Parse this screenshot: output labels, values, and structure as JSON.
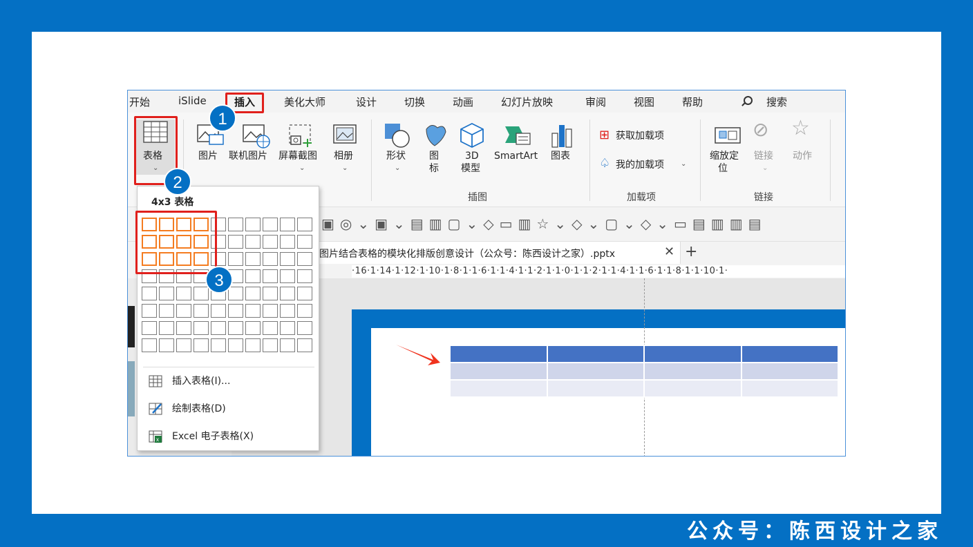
{
  "footer": {
    "text": "公众号：陈西设计之家"
  },
  "menu": {
    "tabs": [
      "开始",
      "iSlide",
      "插入",
      "美化大师",
      "设计",
      "切换",
      "动画",
      "幻灯片放映",
      "审阅",
      "视图",
      "帮助"
    ],
    "active": "插入",
    "search_label": "搜索"
  },
  "ribbon": {
    "table": {
      "label": "表格"
    },
    "images": {
      "picture": "图片",
      "online_picture": "联机图片",
      "screenshot": "屏幕截图",
      "album": "相册"
    },
    "illustrations": {
      "shapes": "形状",
      "icons_1": "图",
      "icons_2": "标",
      "model_1": "3D",
      "model_2": "模型",
      "smartart": "SmartArt",
      "chart": "图表",
      "group": "插图"
    },
    "addins": {
      "get": "获取加载项",
      "mine": "我的加载项",
      "group": "加载项"
    },
    "links": {
      "zoom_1": "缩放定",
      "zoom_2": "位",
      "link": "链接",
      "action": "动作",
      "group": "链接"
    }
  },
  "document": {
    "tab_title": "图片结合表格的模块化排版创意设计（公众号：陈西设计之家）.pptx",
    "ruler": "·16·1·14·1·12·1·10·1·8·1·1·6·1·1·4·1·1·2·1·1·0·1·1·2·1·1·4·1·1·6·1·1·8·1·1·10·1·"
  },
  "dropdown": {
    "title": "4x3 表格",
    "grid": {
      "cols": 10,
      "rows": 8,
      "selected_cols": 4,
      "selected_rows": 3
    },
    "items": [
      {
        "label": "插入表格(I)...",
        "icon": "table-icon"
      },
      {
        "label": "绘制表格(D)",
        "icon": "draw-table-icon"
      },
      {
        "label": "Excel 电子表格(X)",
        "icon": "excel-icon"
      }
    ]
  },
  "badges": [
    "1",
    "2",
    "3"
  ],
  "colors": {
    "brand_blue": "#0470c4",
    "highlight_red": "#e0201c",
    "grid_orange": "#f47c20",
    "table_header": "#4472c4"
  }
}
